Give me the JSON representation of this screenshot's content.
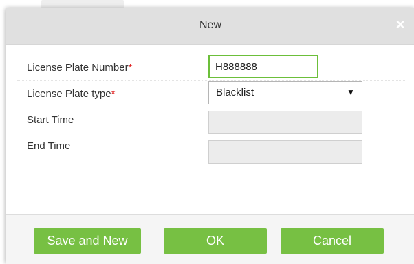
{
  "dialog": {
    "title": "New",
    "close_icon": "×"
  },
  "form": {
    "license_plate_number": {
      "label": "License Plate Number",
      "required_mark": "*",
      "value": "H888888"
    },
    "license_plate_type": {
      "label": "License Plate type",
      "required_mark": "*",
      "selected": "Blacklist",
      "arrow": "▼"
    },
    "start_time": {
      "label": "Start Time",
      "value": ""
    },
    "end_time": {
      "label": "End Time",
      "value": ""
    }
  },
  "buttons": {
    "save_and_new": "Save and New",
    "ok": "OK",
    "cancel": "Cancel"
  },
  "colors": {
    "accent_green": "#77c043",
    "required_red": "#e02020",
    "title_bar": "#e0e0e0"
  }
}
